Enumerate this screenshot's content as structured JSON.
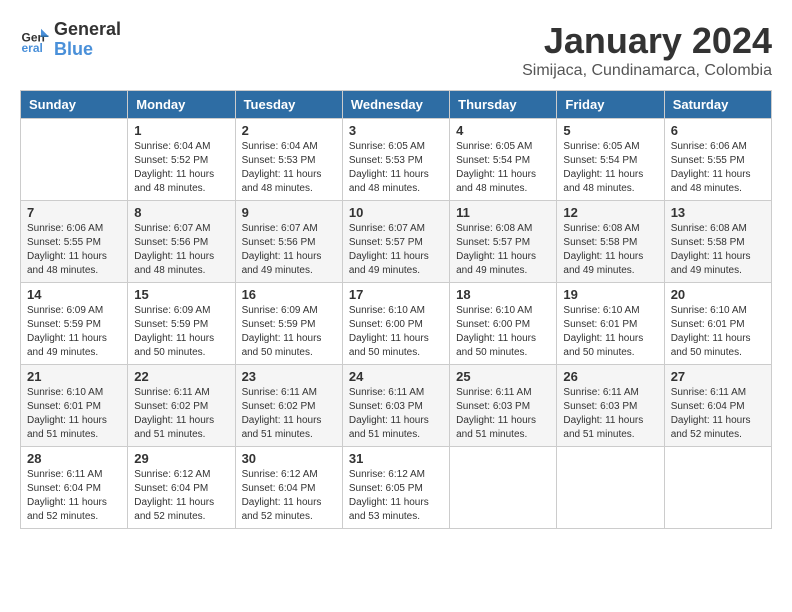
{
  "header": {
    "logo_line1": "General",
    "logo_line2": "Blue",
    "title": "January 2024",
    "subtitle": "Simijaca, Cundinamarca, Colombia"
  },
  "days_of_week": [
    "Sunday",
    "Monday",
    "Tuesday",
    "Wednesday",
    "Thursday",
    "Friday",
    "Saturday"
  ],
  "weeks": [
    [
      {
        "day": "",
        "info": ""
      },
      {
        "day": "1",
        "info": "Sunrise: 6:04 AM\nSunset: 5:52 PM\nDaylight: 11 hours\nand 48 minutes."
      },
      {
        "day": "2",
        "info": "Sunrise: 6:04 AM\nSunset: 5:53 PM\nDaylight: 11 hours\nand 48 minutes."
      },
      {
        "day": "3",
        "info": "Sunrise: 6:05 AM\nSunset: 5:53 PM\nDaylight: 11 hours\nand 48 minutes."
      },
      {
        "day": "4",
        "info": "Sunrise: 6:05 AM\nSunset: 5:54 PM\nDaylight: 11 hours\nand 48 minutes."
      },
      {
        "day": "5",
        "info": "Sunrise: 6:05 AM\nSunset: 5:54 PM\nDaylight: 11 hours\nand 48 minutes."
      },
      {
        "day": "6",
        "info": "Sunrise: 6:06 AM\nSunset: 5:55 PM\nDaylight: 11 hours\nand 48 minutes."
      }
    ],
    [
      {
        "day": "7",
        "info": "Sunrise: 6:06 AM\nSunset: 5:55 PM\nDaylight: 11 hours\nand 48 minutes."
      },
      {
        "day": "8",
        "info": "Sunrise: 6:07 AM\nSunset: 5:56 PM\nDaylight: 11 hours\nand 48 minutes."
      },
      {
        "day": "9",
        "info": "Sunrise: 6:07 AM\nSunset: 5:56 PM\nDaylight: 11 hours\nand 49 minutes."
      },
      {
        "day": "10",
        "info": "Sunrise: 6:07 AM\nSunset: 5:57 PM\nDaylight: 11 hours\nand 49 minutes."
      },
      {
        "day": "11",
        "info": "Sunrise: 6:08 AM\nSunset: 5:57 PM\nDaylight: 11 hours\nand 49 minutes."
      },
      {
        "day": "12",
        "info": "Sunrise: 6:08 AM\nSunset: 5:58 PM\nDaylight: 11 hours\nand 49 minutes."
      },
      {
        "day": "13",
        "info": "Sunrise: 6:08 AM\nSunset: 5:58 PM\nDaylight: 11 hours\nand 49 minutes."
      }
    ],
    [
      {
        "day": "14",
        "info": "Sunrise: 6:09 AM\nSunset: 5:59 PM\nDaylight: 11 hours\nand 49 minutes."
      },
      {
        "day": "15",
        "info": "Sunrise: 6:09 AM\nSunset: 5:59 PM\nDaylight: 11 hours\nand 50 minutes."
      },
      {
        "day": "16",
        "info": "Sunrise: 6:09 AM\nSunset: 5:59 PM\nDaylight: 11 hours\nand 50 minutes."
      },
      {
        "day": "17",
        "info": "Sunrise: 6:10 AM\nSunset: 6:00 PM\nDaylight: 11 hours\nand 50 minutes."
      },
      {
        "day": "18",
        "info": "Sunrise: 6:10 AM\nSunset: 6:00 PM\nDaylight: 11 hours\nand 50 minutes."
      },
      {
        "day": "19",
        "info": "Sunrise: 6:10 AM\nSunset: 6:01 PM\nDaylight: 11 hours\nand 50 minutes."
      },
      {
        "day": "20",
        "info": "Sunrise: 6:10 AM\nSunset: 6:01 PM\nDaylight: 11 hours\nand 50 minutes."
      }
    ],
    [
      {
        "day": "21",
        "info": "Sunrise: 6:10 AM\nSunset: 6:01 PM\nDaylight: 11 hours\nand 51 minutes."
      },
      {
        "day": "22",
        "info": "Sunrise: 6:11 AM\nSunset: 6:02 PM\nDaylight: 11 hours\nand 51 minutes."
      },
      {
        "day": "23",
        "info": "Sunrise: 6:11 AM\nSunset: 6:02 PM\nDaylight: 11 hours\nand 51 minutes."
      },
      {
        "day": "24",
        "info": "Sunrise: 6:11 AM\nSunset: 6:03 PM\nDaylight: 11 hours\nand 51 minutes."
      },
      {
        "day": "25",
        "info": "Sunrise: 6:11 AM\nSunset: 6:03 PM\nDaylight: 11 hours\nand 51 minutes."
      },
      {
        "day": "26",
        "info": "Sunrise: 6:11 AM\nSunset: 6:03 PM\nDaylight: 11 hours\nand 51 minutes."
      },
      {
        "day": "27",
        "info": "Sunrise: 6:11 AM\nSunset: 6:04 PM\nDaylight: 11 hours\nand 52 minutes."
      }
    ],
    [
      {
        "day": "28",
        "info": "Sunrise: 6:11 AM\nSunset: 6:04 PM\nDaylight: 11 hours\nand 52 minutes."
      },
      {
        "day": "29",
        "info": "Sunrise: 6:12 AM\nSunset: 6:04 PM\nDaylight: 11 hours\nand 52 minutes."
      },
      {
        "day": "30",
        "info": "Sunrise: 6:12 AM\nSunset: 6:04 PM\nDaylight: 11 hours\nand 52 minutes."
      },
      {
        "day": "31",
        "info": "Sunrise: 6:12 AM\nSunset: 6:05 PM\nDaylight: 11 hours\nand 53 minutes."
      },
      {
        "day": "",
        "info": ""
      },
      {
        "day": "",
        "info": ""
      },
      {
        "day": "",
        "info": ""
      }
    ]
  ]
}
